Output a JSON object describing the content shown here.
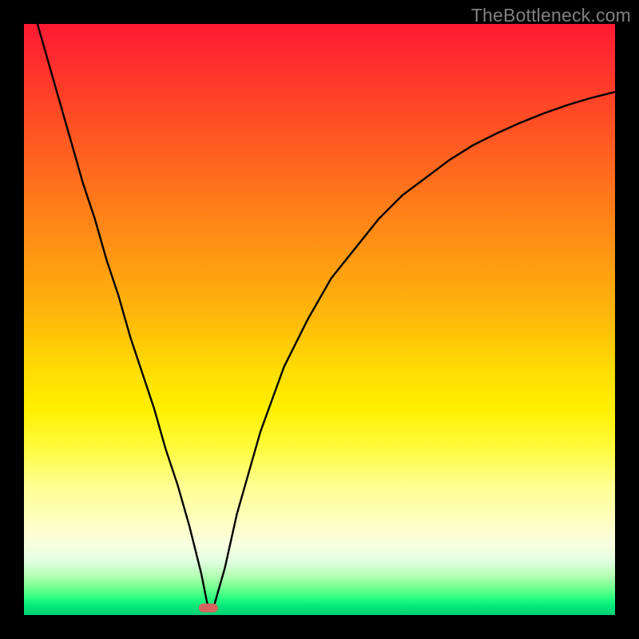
{
  "watermark": "TheBottleneck.com",
  "chart_data": {
    "type": "line",
    "title": "",
    "xlabel": "",
    "ylabel": "",
    "xlim": [
      0,
      100
    ],
    "ylim": [
      0,
      100
    ],
    "background": "rainbow-gradient (red top to green bottom)",
    "grid": false,
    "legend": false,
    "series": [
      {
        "name": "bottleneck-curve",
        "x": [
          0,
          2,
          4,
          6,
          8,
          10,
          12,
          14,
          16,
          18,
          20,
          22,
          24,
          26,
          28,
          30,
          31,
          32,
          34,
          36,
          38,
          40,
          44,
          48,
          52,
          56,
          60,
          64,
          68,
          72,
          76,
          80,
          84,
          88,
          92,
          96,
          100
        ],
        "values": [
          108,
          101,
          94,
          87,
          80,
          73,
          67,
          60,
          54,
          47,
          41,
          35,
          28,
          22,
          15,
          7,
          2,
          1,
          8,
          17,
          24,
          31,
          42,
          50,
          57,
          62,
          67,
          71,
          74,
          77,
          79.5,
          81.5,
          83.3,
          84.9,
          86.3,
          87.5,
          88.5
        ]
      }
    ],
    "marker": {
      "x": 31.2,
      "y": 1.2,
      "shape": "rounded-capsule",
      "color": "#d6635e"
    }
  }
}
